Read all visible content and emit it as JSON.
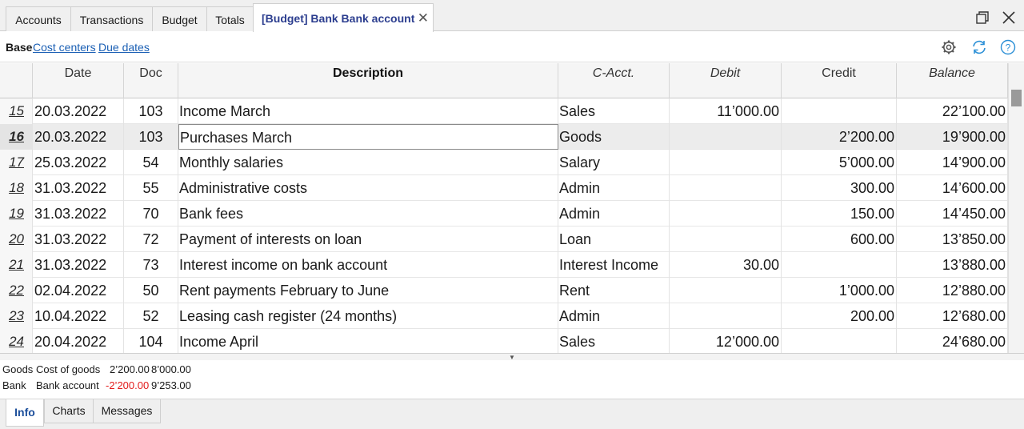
{
  "tabs": [
    {
      "label": "Accounts"
    },
    {
      "label": "Transactions"
    },
    {
      "label": "Budget"
    },
    {
      "label": "Totals"
    },
    {
      "label": "[Budget] Bank Bank account",
      "active": true
    }
  ],
  "views": {
    "base_label": "Base",
    "cost_centers_label": "Cost centers",
    "due_dates_label": "Due dates"
  },
  "icons": {
    "close_tab": "close-icon",
    "restore_window": "restore-window-icon",
    "close_window": "close-window-icon",
    "settings": "gear-icon",
    "refresh": "refresh-icon",
    "help": "help-icon"
  },
  "columns": {
    "date": "Date",
    "doc": "Doc",
    "description": "Description",
    "cacct": "C-Acct.",
    "debit": "Debit",
    "credit": "Credit",
    "balance": "Balance"
  },
  "rows": [
    {
      "num": "15",
      "date": "20.03.2022",
      "doc": "103",
      "description": "Income March",
      "cacct": "Sales",
      "debit": "11’000.00",
      "credit": "",
      "balance": "22’100.00"
    },
    {
      "num": "16",
      "date": "20.03.2022",
      "doc": "103",
      "description": "Purchases March",
      "cacct": "Goods",
      "debit": "",
      "credit": "2’200.00",
      "balance": "19’900.00"
    },
    {
      "num": "17",
      "date": "25.03.2022",
      "doc": "54",
      "description": "Monthly salaries",
      "cacct": "Salary",
      "debit": "",
      "credit": "5’000.00",
      "balance": "14’900.00"
    },
    {
      "num": "18",
      "date": "31.03.2022",
      "doc": "55",
      "description": "Administrative costs",
      "cacct": "Admin",
      "debit": "",
      "credit": "300.00",
      "balance": "14’600.00"
    },
    {
      "num": "19",
      "date": "31.03.2022",
      "doc": "70",
      "description": "Bank fees",
      "cacct": "Admin",
      "debit": "",
      "credit": "150.00",
      "balance": "14’450.00"
    },
    {
      "num": "20",
      "date": "31.03.2022",
      "doc": "72",
      "description": "Payment of interests on loan",
      "cacct": "Loan",
      "debit": "",
      "credit": "600.00",
      "balance": "13’850.00"
    },
    {
      "num": "21",
      "date": "31.03.2022",
      "doc": "73",
      "description": "Interest income on bank account",
      "cacct": "Interest Income",
      "debit": "30.00",
      "credit": "",
      "balance": "13’880.00"
    },
    {
      "num": "22",
      "date": "02.04.2022",
      "doc": "50",
      "description": "Rent payments February to June",
      "cacct": "Rent",
      "debit": "",
      "credit": "1’000.00",
      "balance": "12’880.00"
    },
    {
      "num": "23",
      "date": "10.04.2022",
      "doc": "52",
      "description": "Leasing cash register (24 months)",
      "cacct": "Admin",
      "debit": "",
      "credit": "200.00",
      "balance": "12’680.00"
    },
    {
      "num": "24",
      "date": "20.04.2022",
      "doc": "104",
      "description": "Income April",
      "cacct": "Sales",
      "debit": "12’000.00",
      "credit": "",
      "balance": "24’680.00"
    }
  ],
  "selected_row": "16",
  "info": {
    "line1": {
      "account": "Goods",
      "description": "Cost of goods",
      "amount": "2’200.00",
      "balance": "8’000.00"
    },
    "line2": {
      "account": "Bank",
      "description": "Bank account",
      "amount": "-2’200.00",
      "balance": "9’253.00"
    }
  },
  "bottom_tabs": [
    {
      "label": "Info",
      "active": true
    },
    {
      "label": "Charts"
    },
    {
      "label": "Messages"
    }
  ],
  "colors": {
    "active_tab_text": "#2c3e8f",
    "link": "#1a5fb4",
    "negative": "#e31b1b",
    "icon_blue": "#2b8fd6"
  }
}
